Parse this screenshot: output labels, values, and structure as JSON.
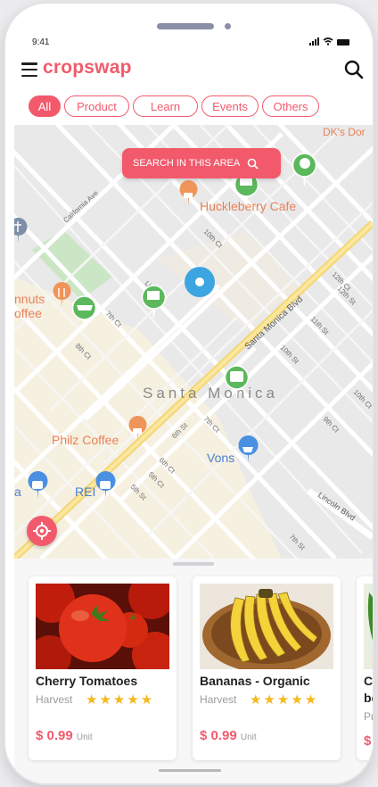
{
  "status_bar": {
    "time": "9:41"
  },
  "header": {
    "logo": "cropswap"
  },
  "tabs": [
    {
      "label": "All",
      "active": true
    },
    {
      "label": "Product",
      "active": false
    },
    {
      "label": "Learn",
      "active": false
    },
    {
      "label": "Events",
      "active": false
    },
    {
      "label": "Others",
      "active": false
    }
  ],
  "map": {
    "search_button": "SEARCH IN THIS AREA",
    "place_labels": {
      "dks": "DK's Dor",
      "huckleberry": "Huckleberry Cafe",
      "philz": "Philz Coffee",
      "vons": "Vons",
      "rei": "REI",
      "santa_monica": "Santa Monica",
      "donuts_line1": "nnuts",
      "donuts_line2": "offee",
      "left_a": "a"
    },
    "street_labels": {
      "california": "California Ave",
      "santa_monica_blvd": "Santa Monica Blvd",
      "lincoln": "Lincoln Blvd",
      "s10th_ct": "10th Ct",
      "s10th_st": "10th St",
      "s11th_st": "11th St",
      "s12th_ct": "12th Ct",
      "s12th_st": "12th St",
      "s10th_ct2": "10th Ct",
      "s9th_ct": "9th Ct",
      "s8th_ct": "8th Ct",
      "s7th_ct": "7th Ct",
      "s7th_ct2": "7th Ct",
      "s6th_ct": "6th Ct",
      "s5th_ct": "5th Ct",
      "s7th_st": "7th St",
      "s6th_st": "6th St",
      "s5th_st": "5th St",
      "s9th_st": "9th St",
      "lin_st": "Lin"
    }
  },
  "products": [
    {
      "name": "Cherry Tomatoes",
      "source": "Harvest",
      "stars": "★★★★★",
      "price": "$ 0.99",
      "unit": "Unit"
    },
    {
      "name": "Bananas - Organic",
      "source": "Harvest",
      "stars": "★★★★★",
      "price": "$ 0.99",
      "unit": "Unit"
    },
    {
      "name_line1": "Ch",
      "name_line2": "be",
      "source": "Pr",
      "price": "$"
    }
  ],
  "colors": {
    "accent": "#f25a6c",
    "pin_green": "#5cb85c",
    "pin_orange": "#f0955a",
    "pin_blue": "#4a90e2",
    "star": "#f6b81c"
  }
}
